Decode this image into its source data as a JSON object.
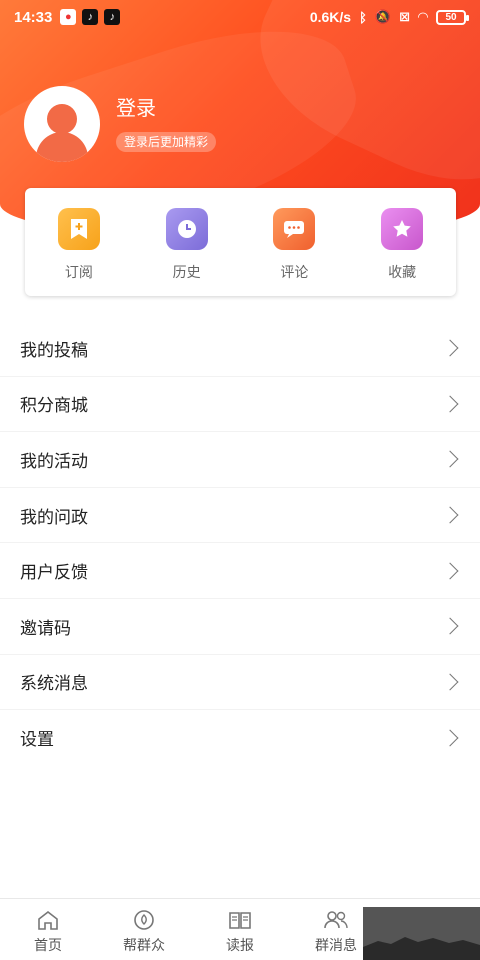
{
  "statusbar": {
    "time": "14:33",
    "speed": "0.6K/s",
    "battery": "50",
    "icons": [
      "app-icon",
      "tiktok-icon",
      "tiktok-icon",
      "bluetooth-icon",
      "mute-icon",
      "sim-off-icon",
      "wifi-icon",
      "battery-icon"
    ]
  },
  "profile": {
    "login_label": "登录",
    "login_subtitle": "登录后更加精彩"
  },
  "quick_actions": [
    {
      "label": "订阅",
      "icon": "subscribe-icon",
      "color": "#f7a21a"
    },
    {
      "label": "历史",
      "icon": "history-icon",
      "color": "#8f7fe0"
    },
    {
      "label": "评论",
      "icon": "comment-icon",
      "color": "#f5733e"
    },
    {
      "label": "收藏",
      "icon": "star-icon",
      "color": "#d66bd9"
    }
  ],
  "menu": [
    {
      "label": "我的投稿"
    },
    {
      "label": "积分商城"
    },
    {
      "label": "我的活动"
    },
    {
      "label": "我的问政"
    },
    {
      "label": "用户反馈"
    },
    {
      "label": "邀请码"
    },
    {
      "label": "系统消息"
    },
    {
      "label": "设置"
    }
  ],
  "bottom_nav": [
    {
      "label": "首页",
      "icon": "home-icon"
    },
    {
      "label": "帮群众",
      "icon": "help-icon"
    },
    {
      "label": "读报",
      "icon": "newspaper-icon"
    },
    {
      "label": "群消息",
      "icon": "group-icon"
    }
  ],
  "colors": {
    "accent": "#f0301c",
    "header_start": "#ff7a3a"
  }
}
